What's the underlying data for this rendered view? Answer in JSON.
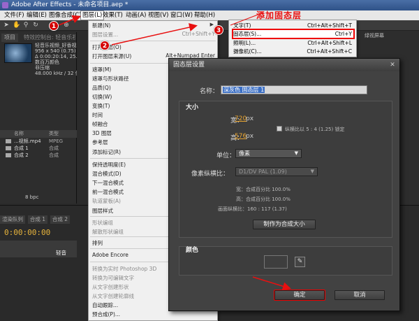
{
  "window": {
    "title": "Adobe After Effects - 未命名项目.aep *"
  },
  "menubar": [
    {
      "label": "文件(F)"
    },
    {
      "label": "编辑(E)"
    },
    {
      "label": "图像合成(C)"
    },
    {
      "label": "图层(L)"
    },
    {
      "label": "效果(T)"
    },
    {
      "label": "动画(A)"
    },
    {
      "label": "视图(V)"
    },
    {
      "label": "窗口(W)"
    },
    {
      "label": "帮助(H)"
    }
  ],
  "project": {
    "tab": "项目",
    "controls_tab": "特效控制台: 轻音乐视频_好",
    "info_lines": [
      "轻音乐视频_好香视",
      "956 x 540 (0.75)",
      "Δ 0:00:20:14, 25.00 fps",
      "数百万颜色",
      "非压缩",
      "48.000 kHz / 32 位 U"
    ],
    "list_header": "名称",
    "type_header": "类型",
    "rows": [
      {
        "name": "...视频.mp4",
        "kind": "MPEG"
      },
      {
        "name": "合成 1",
        "kind": "合成"
      },
      {
        "name": "合成 2",
        "kind": "合成"
      }
    ],
    "bpc": "8 bpc"
  },
  "right_panel": {
    "tab": "绿视屏幕"
  },
  "timeline": {
    "tabs": [
      "渲染队列",
      "合成 1",
      "合成 2"
    ],
    "time": "0:00:00:00",
    "layer_label": "轻音"
  },
  "layer_menu": {
    "items": [
      {
        "label": "新建(N)",
        "shortcut": "",
        "disabled": false,
        "arrow": true
      },
      {
        "label": "图层设置...",
        "shortcut": "Ctrl+Shift+Y",
        "disabled": true
      },
      {
        "label": "打开图层(O)",
        "shortcut": "",
        "disabled": false
      },
      {
        "label": "打开图层来源(U)",
        "shortcut": "Alt+Numpad Enter",
        "disabled": false
      },
      {
        "label": "遮罩(M)",
        "shortcut": "",
        "disabled": false,
        "arrow": true
      },
      {
        "label": "遮罩与形状路径",
        "shortcut": "",
        "disabled": false,
        "arrow": true
      },
      {
        "label": "品质(Q)",
        "shortcut": "",
        "disabled": false,
        "arrow": true
      },
      {
        "label": "切换(W)",
        "shortcut": "",
        "disabled": false,
        "arrow": true
      },
      {
        "label": "变换(T)",
        "shortcut": "",
        "disabled": false,
        "arrow": true
      },
      {
        "label": "时间",
        "shortcut": "",
        "disabled": false,
        "arrow": true
      },
      {
        "label": "帧融合",
        "shortcut": "",
        "disabled": false,
        "arrow": true
      },
      {
        "label": "3D 图层",
        "shortcut": "",
        "disabled": false
      },
      {
        "label": "参考层",
        "shortcut": "",
        "disabled": false
      },
      {
        "label": "添加标记(R)",
        "shortcut": "",
        "disabled": false
      },
      {
        "label": "保持透明度(E)",
        "shortcut": "",
        "disabled": false
      },
      {
        "label": "混合模式(D)",
        "shortcut": "",
        "disabled": false,
        "arrow": true
      },
      {
        "label": "下一混合模式",
        "shortcut": "",
        "disabled": false
      },
      {
        "label": "前一混合模式",
        "shortcut": "",
        "disabled": false
      },
      {
        "label": "轨道蒙板(A)",
        "shortcut": "",
        "disabled": true,
        "arrow": true
      },
      {
        "label": "图层样式",
        "shortcut": "",
        "disabled": false,
        "arrow": true
      },
      {
        "label": "形状编组",
        "shortcut": "",
        "disabled": true
      },
      {
        "label": "解散形状编组",
        "shortcut": "",
        "disabled": true
      },
      {
        "label": "排列",
        "shortcut": "",
        "disabled": false,
        "arrow": true
      },
      {
        "label": "Adobe Encore",
        "shortcut": "",
        "disabled": false,
        "arrow": true
      },
      {
        "label": "转换为实时 Photoshop 3D",
        "shortcut": "",
        "disabled": true
      },
      {
        "label": "转换为可编辑文字",
        "shortcut": "",
        "disabled": true
      },
      {
        "label": "从文字创建形状",
        "shortcut": "",
        "disabled": true
      },
      {
        "label": "从文字创建轮廓线",
        "shortcut": "",
        "disabled": true
      },
      {
        "label": "自动跟踪...",
        "shortcut": "",
        "disabled": false
      },
      {
        "label": "预合成(P)...",
        "shortcut": "",
        "disabled": false
      }
    ]
  },
  "new_submenu": [
    {
      "label": "文字(T)",
      "shortcut": "Ctrl+Alt+Shift+T"
    },
    {
      "label": "固态层(S)...",
      "shortcut": "Ctrl+Y",
      "highlight": true
    },
    {
      "label": "照明(L)...",
      "shortcut": "Ctrl+Alt+Shift+L"
    },
    {
      "label": "摄像机(C)...",
      "shortcut": "Ctrl+Alt+Shift+C"
    }
  ],
  "annotation": {
    "title": "添加固态层",
    "markers": [
      "1",
      "2",
      "3"
    ]
  },
  "dialog": {
    "title": "固态层设置",
    "name_label": "名称：",
    "name_value": "深灰色 固态层 1",
    "size_section": "大小",
    "width_label": "宽：",
    "width_value": "720",
    "height_label": "高：",
    "height_value": "576",
    "unit_px": "px",
    "aspect_lock_label": "纵横比以 5 : 4 (1.25) 锁定",
    "units_label": "单位：",
    "units_value": "像素",
    "pixel_aspect_label": "像素纵横比：",
    "pixel_aspect_value": "D1/DV PAL (1.09)",
    "info_width": "宽：合成百分比 100.0%",
    "info_height": "高：合成百分比 100.0%",
    "info_frame": "画面纵横比：160 : 117 (1.37)",
    "make_comp_size": "制作为合成大小",
    "color_section": "颜色",
    "ok": "确定",
    "cancel": "取消"
  }
}
